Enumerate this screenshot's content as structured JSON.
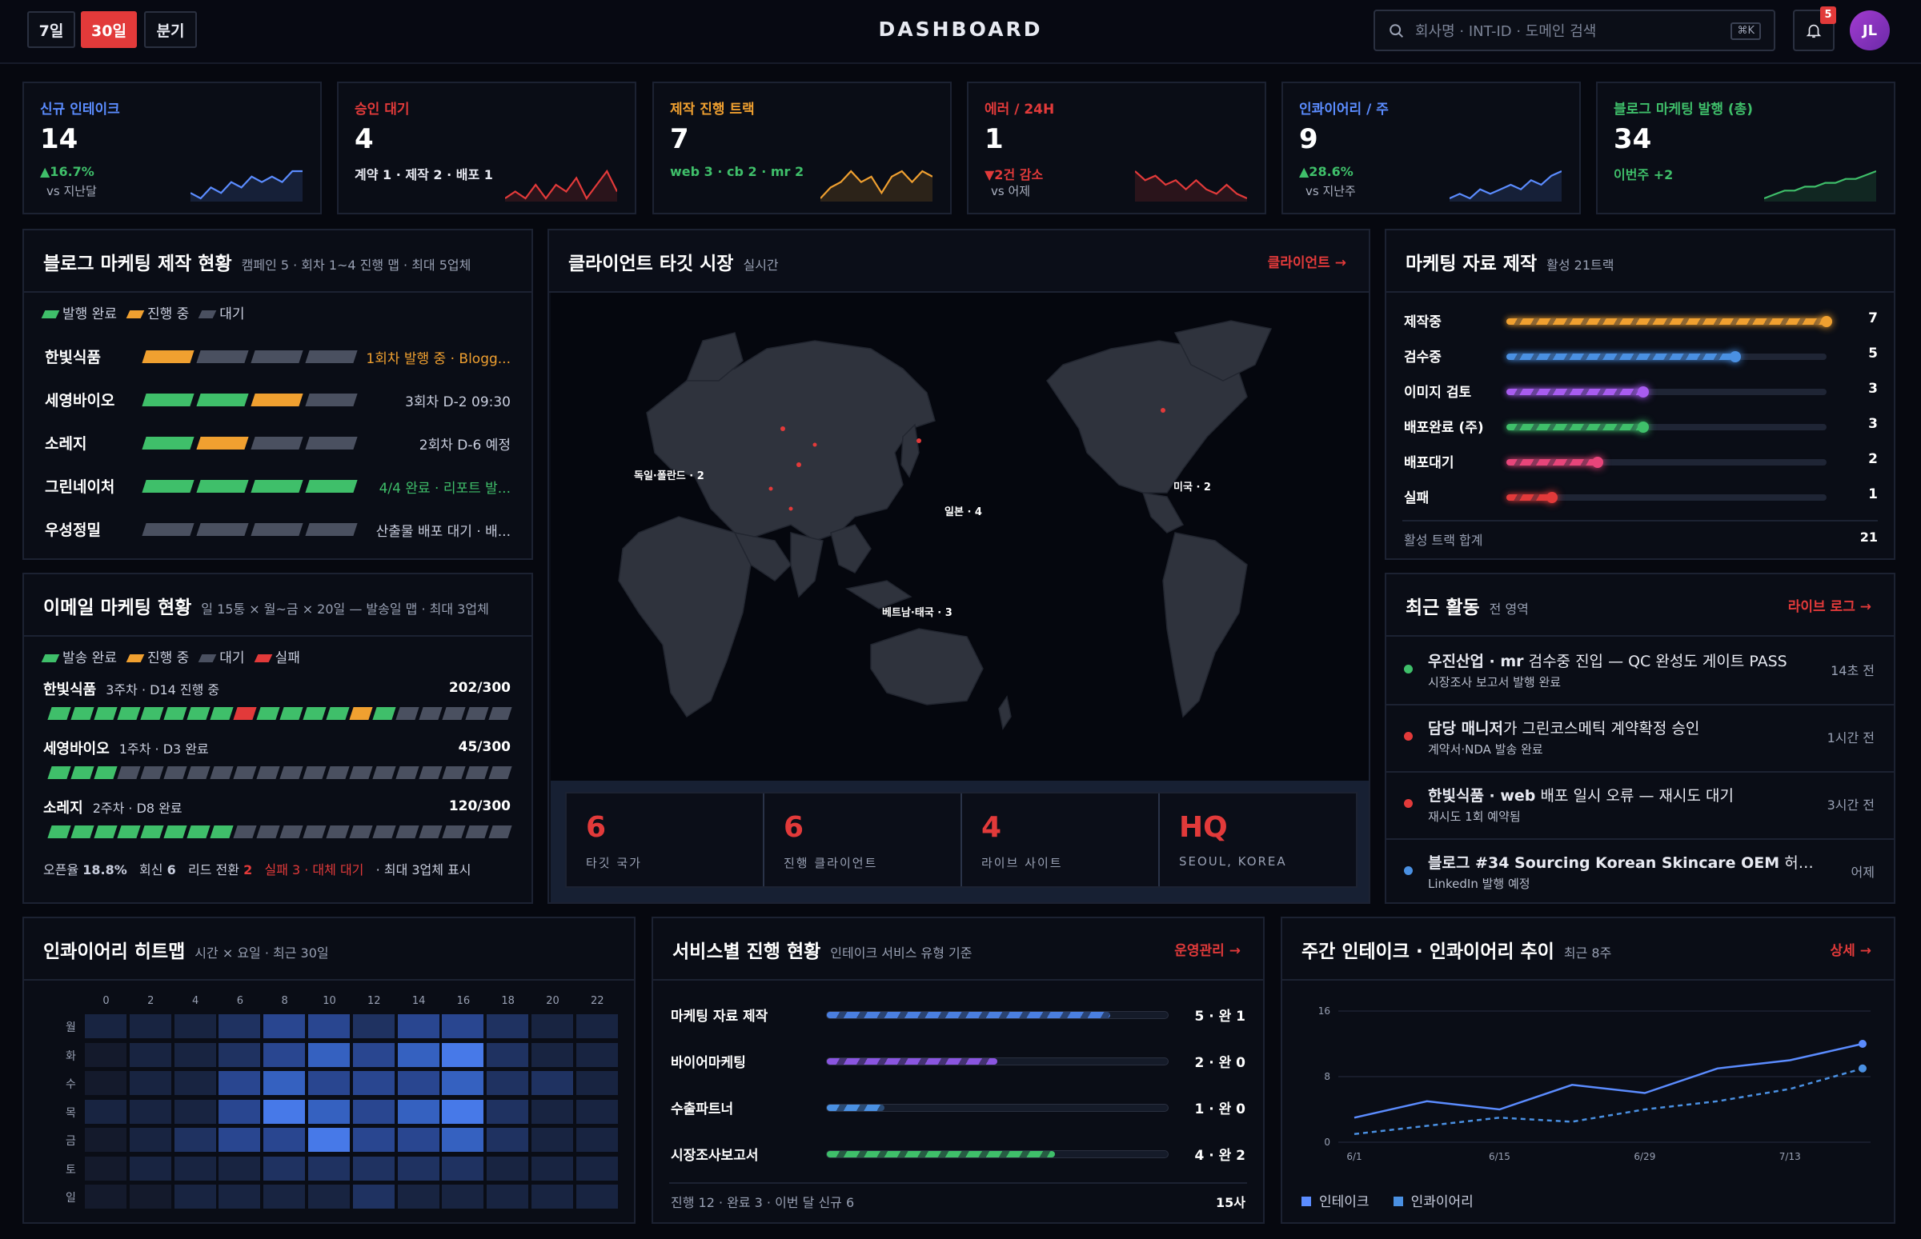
{
  "header": {
    "range_tabs": [
      "7일",
      "30일",
      "분기"
    ],
    "active_tab": "30일",
    "title": "DASHBOARD",
    "search_placeholder": "회사명 · INT-ID · 도메인 검색",
    "search_shortcut": "⌘K",
    "notifications": "5",
    "avatar_initials": "JL"
  },
  "kpis": [
    {
      "label": "신규 인테이크",
      "value": "14",
      "delta": "▲16.7%",
      "sub": "vs 지난달",
      "color": "#5b8cff",
      "delta_color": "#3fbf6a",
      "spark": [
        4,
        3,
        5,
        4,
        6,
        5,
        7,
        6,
        7,
        6,
        8,
        8
      ]
    },
    {
      "label": "승인 대기",
      "value": "4",
      "delta": "계약 1 · 제작 2 · 배포 1",
      "sub": "",
      "color": "#e23a3a",
      "delta_color": "#e8eaf2",
      "spark": [
        3,
        4,
        3,
        5,
        3,
        5,
        4,
        6,
        3,
        5,
        7,
        4
      ]
    },
    {
      "label": "제작 진행 트랙",
      "value": "7",
      "delta": "web 3 · cb 2 · mr 2",
      "sub": "",
      "color": "#f0a030",
      "delta_color": "#3fbf6a",
      "spark": [
        2,
        4,
        5,
        7,
        5,
        6,
        3,
        6,
        7,
        5,
        7,
        6
      ]
    },
    {
      "label": "에러 / 24H",
      "value": "1",
      "delta": "▼2건 감소",
      "sub": "vs 어제",
      "color": "#e23a3a",
      "delta_color": "#e23a3a",
      "spark": [
        8,
        6,
        7,
        5,
        6,
        4,
        6,
        4,
        3,
        5,
        3,
        2
      ]
    },
    {
      "label": "인콰이어리 / 주",
      "value": "9",
      "delta": "▲28.6%",
      "sub": "vs 지난주",
      "color": "#5b8cff",
      "delta_color": "#3fbf6a",
      "spark": [
        2,
        3,
        2,
        4,
        3,
        4,
        5,
        4,
        6,
        5,
        7,
        8
      ]
    },
    {
      "label": "블로그 마케팅 발행 (총)",
      "value": "34",
      "delta": "이번주 +2",
      "sub": "",
      "color": "#3fbf6a",
      "delta_color": "#3fbf6a",
      "spark": [
        1,
        2,
        3,
        3,
        4,
        4,
        5,
        5,
        6,
        6,
        7,
        8
      ]
    }
  ],
  "blog": {
    "title": "블로그 마케팅 제작 현황",
    "subtitle": "캠페인 5 · 회차 1~4 진행 맵 · 최대 5업체",
    "legend": [
      "발행 완료",
      "진행 중",
      "대기"
    ],
    "rows": [
      {
        "name": "한빛식품",
        "segs": [
          "o",
          "g",
          "g",
          "g"
        ],
        "status": "1회차 발행 중 · Blogg...",
        "status_color": "#f0a030"
      },
      {
        "name": "세영바이오",
        "segs": [
          "n",
          "n",
          "o",
          "g"
        ],
        "status": "3회차 D-2 09:30",
        "status_color": "#c9cede"
      },
      {
        "name": "소레지",
        "segs": [
          "n",
          "o",
          "g",
          "g"
        ],
        "status": "2회차 D-6 예정",
        "status_color": "#c9cede"
      },
      {
        "name": "그린네이처",
        "segs": [
          "n",
          "n",
          "n",
          "n"
        ],
        "status": "4/4 완료 · 리포트 발...",
        "status_color": "#3fbf6a"
      },
      {
        "name": "우성정밀",
        "segs": [
          "g",
          "g",
          "g",
          "g"
        ],
        "status": "산출물 배포 대기 · 배...",
        "status_color": "#c9cede"
      }
    ]
  },
  "email": {
    "title": "이메일 마케팅 현황",
    "subtitle": "일 15통 × 월~금 × 20일 — 발송일 맵 · 최대 3업체",
    "legend": [
      "발송 완료",
      "진행 중",
      "대기",
      "실패"
    ],
    "rows": [
      {
        "name": "한빛식품",
        "detail": "3주차 · D14 진행 중",
        "count": "202/300",
        "cells": "nnnnnnnnrnnnnonggggg"
      },
      {
        "name": "세영바이오",
        "detail": "1주차 · D3 완료",
        "count": "45/300",
        "cells": "nnnggggggggggggggggg"
      },
      {
        "name": "소레지",
        "detail": "2주차 · D8 완료",
        "count": "120/300",
        "cells": "nnnnnnnnggggggggggggg"
      }
    ],
    "stats": {
      "open_label": "오픈율",
      "open": "18.8%",
      "reply_label": "회신",
      "reply": "6",
      "lead_label": "리드 전환",
      "lead": "2",
      "fail": "실패 3 · 대체 대기",
      "note": "· 최대 3업체 표시"
    }
  },
  "map": {
    "title": "클라이언트 타깃 시장",
    "subtitle": "실시간",
    "link": "클라이언트 →",
    "labels": [
      "독일·폴란드 · 2",
      "일본 · 4",
      "미국 · 2",
      "베트남·태국 · 3"
    ],
    "stats": [
      {
        "num": "6",
        "label": "타깃 국가"
      },
      {
        "num": "6",
        "label": "진행 클라이언트"
      },
      {
        "num": "4",
        "label": "라이브 사이트"
      },
      {
        "num": "HQ",
        "label": "SEOUL, KOREA"
      }
    ]
  },
  "marketing": {
    "title": "마케팅 자료 제작",
    "subtitle": "활성 21트랙",
    "rows": [
      {
        "name": "제작중",
        "count": "7",
        "value": 7,
        "color": "#f0a030"
      },
      {
        "name": "검수중",
        "count": "5",
        "value": 5,
        "color": "#4a90e2"
      },
      {
        "name": "이미지 검토",
        "count": "3",
        "value": 3,
        "color": "#a85cf0"
      },
      {
        "name": "배포완료 (주)",
        "count": "3",
        "value": 3,
        "color": "#3fbf6a"
      },
      {
        "name": "배포대기",
        "count": "2",
        "value": 2,
        "color": "#e8457a"
      },
      {
        "name": "실패",
        "count": "1",
        "value": 1,
        "color": "#e23a3a"
      }
    ],
    "max": 7,
    "total_label": "활성 트랙 합계",
    "total": "21"
  },
  "activity": {
    "title": "최근 활동",
    "subtitle": "전 영역",
    "link": "라이브 로그 →",
    "items": [
      {
        "bold": "우진산업 · mr",
        "text": " 검수중 진입 — QC 완성도 게이트 PASS",
        "sub": "시장조사 보고서 발행 완료",
        "time": "14초 전",
        "dot": "#3fbf6a"
      },
      {
        "bold": "담당 매니저",
        "text": "가 그린코스메틱 계약확정 승인",
        "sub": "계약서·NDA 발송 완료",
        "time": "1시간 전",
        "dot": "#e23a3a"
      },
      {
        "bold": "한빛식품 · web",
        "text": " 배포 일시 오류 — 재시도 대기",
        "sub": "재시도 1회 예약됨",
        "time": "3시간 전",
        "dot": "#e23a3a"
      },
      {
        "bold": "블로그 #34 Sourcing Korean Skincare OEM",
        "text": " 허브+Bl...",
        "sub": "LinkedIn 발행 예정",
        "time": "어제",
        "dot": "#4a90e2"
      }
    ]
  },
  "heatmap": {
    "title": "인콰이어리 히트맵",
    "subtitle": "시간 × 요일 · 최근 30일",
    "hours": [
      "0",
      "2",
      "4",
      "6",
      "8",
      "10",
      "12",
      "14",
      "16",
      "18",
      "20",
      "22"
    ],
    "days": [
      "월",
      "화",
      "수",
      "목",
      "금",
      "토",
      "일"
    ],
    "values": [
      [
        1,
        1,
        1,
        2,
        3,
        3,
        2,
        3,
        3,
        2,
        1,
        1
      ],
      [
        0,
        1,
        1,
        2,
        3,
        4,
        3,
        4,
        5,
        2,
        1,
        1
      ],
      [
        0,
        1,
        1,
        3,
        4,
        3,
        3,
        3,
        4,
        2,
        2,
        1
      ],
      [
        1,
        1,
        1,
        3,
        5,
        4,
        3,
        4,
        5,
        2,
        1,
        1
      ],
      [
        0,
        1,
        2,
        3,
        3,
        5,
        3,
        3,
        4,
        2,
        1,
        1
      ],
      [
        0,
        1,
        1,
        1,
        2,
        2,
        2,
        2,
        2,
        1,
        1,
        1
      ],
      [
        0,
        0,
        1,
        1,
        1,
        1,
        2,
        1,
        1,
        1,
        1,
        1
      ]
    ]
  },
  "services": {
    "title": "서비스별 진행 현황",
    "subtitle": "인테이크 서비스 유형 기준",
    "link": "운영관리 →",
    "rows": [
      {
        "name": "마케팅 자료 제작",
        "count": "5 · 완 1",
        "fraction": 0.83,
        "color": "#4a7fe0"
      },
      {
        "name": "바이어마케팅",
        "count": "2 · 완 0",
        "fraction": 0.5,
        "color": "#8a55e0"
      },
      {
        "name": "수출파트너",
        "count": "1 · 완 0",
        "fraction": 0.17,
        "color": "#4a90e2"
      },
      {
        "name": "시장조사보고서",
        "count": "4 · 완 2",
        "fraction": 0.67,
        "color": "#3fbf6a"
      }
    ],
    "footer": "진행 12 · 완료 3 · 이번 달 신규 6",
    "footer_right": "15사"
  },
  "trend": {
    "title": "주간 인테이크 · 인콰이어리 추이",
    "subtitle": "최근 8주",
    "link": "상세 →",
    "legend": [
      "인테이크",
      "인콰이어리"
    ]
  },
  "chart_data": {
    "type": "line",
    "x": [
      "6/1",
      "6/8",
      "6/15",
      "6/22",
      "6/29",
      "7/6",
      "7/13",
      "7/20"
    ],
    "x_tick_labels": [
      "6/1",
      "6/15",
      "6/29",
      "7/13"
    ],
    "y_tick_labels": [
      "0",
      "8",
      "16"
    ],
    "ylim": [
      0,
      16
    ],
    "series": [
      {
        "name": "인테이크",
        "values": [
          3,
          5,
          4,
          7,
          6,
          9,
          10,
          12
        ],
        "color": "#5b8cff",
        "dashed": false
      },
      {
        "name": "인콰이어리",
        "values": [
          1,
          2,
          3,
          2.5,
          4,
          5,
          6.5,
          9
        ],
        "color": "#4a90e2",
        "dashed": true
      }
    ]
  }
}
